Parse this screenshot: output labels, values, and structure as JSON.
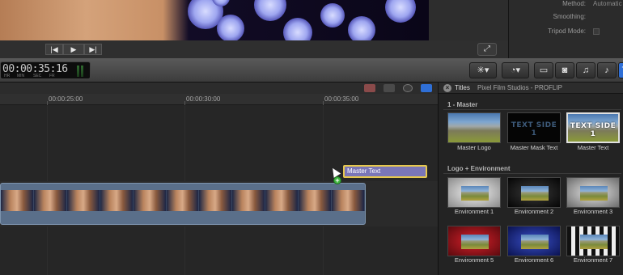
{
  "viewer": {
    "fullscreen_icon": "fullscreen-icon",
    "transport": {
      "previous_icon": "skip-back-icon",
      "play_icon": "play-icon",
      "next_icon": "skip-forward-icon"
    }
  },
  "inspector": {
    "method_label": "Method:",
    "method_value": "Automatic",
    "smoothing_label": "Smoothing:",
    "tripod_label": "Tripod Mode:"
  },
  "toolbar": {
    "timecode": "00:00:35:16",
    "timecode_units": [
      "HR",
      "MIN",
      "SEC",
      "FR"
    ],
    "buttons": [
      {
        "name": "magic-wand-icon",
        "active": false
      },
      {
        "name": "retime-icon",
        "active": false
      },
      {
        "name": "clip-browser-icon",
        "active": false
      },
      {
        "name": "photo-browser-icon",
        "active": false
      },
      {
        "name": "music-browser-icon",
        "active": false
      },
      {
        "name": "titles-browser-icon",
        "active": true
      }
    ]
  },
  "timeline": {
    "ruler_labels": [
      "00:00:25:00",
      "00:00:30:00",
      "00:00:35:00"
    ],
    "title_clip": "Master Text",
    "add_badge": "+"
  },
  "browser": {
    "title": "Titles",
    "subtitle": "Pixel Film Studios - PROFLIP",
    "sections": [
      {
        "title": "1 - Master",
        "items": [
          {
            "label": "Master Logo",
            "selected": false
          },
          {
            "label": "Master Mask Text",
            "preview_text": "TEXT SIDE 1",
            "selected": false
          },
          {
            "label": "Master Text",
            "preview_text": "TEXT SIDE 1",
            "selected": true
          }
        ]
      },
      {
        "title": "Logo + Environment",
        "items": [
          {
            "label": "Environment 1"
          },
          {
            "label": "Environment 2"
          },
          {
            "label": "Environment 3"
          },
          {
            "label": "Environment 5"
          },
          {
            "label": "Environment 6"
          },
          {
            "label": "Environment 7"
          }
        ]
      }
    ]
  },
  "colors": {
    "accent_blue": "#2f6fd6",
    "title_clip": "#7a76b8",
    "title_clip_border": "#e6c84e",
    "video_clip": "#5a6f8a"
  }
}
